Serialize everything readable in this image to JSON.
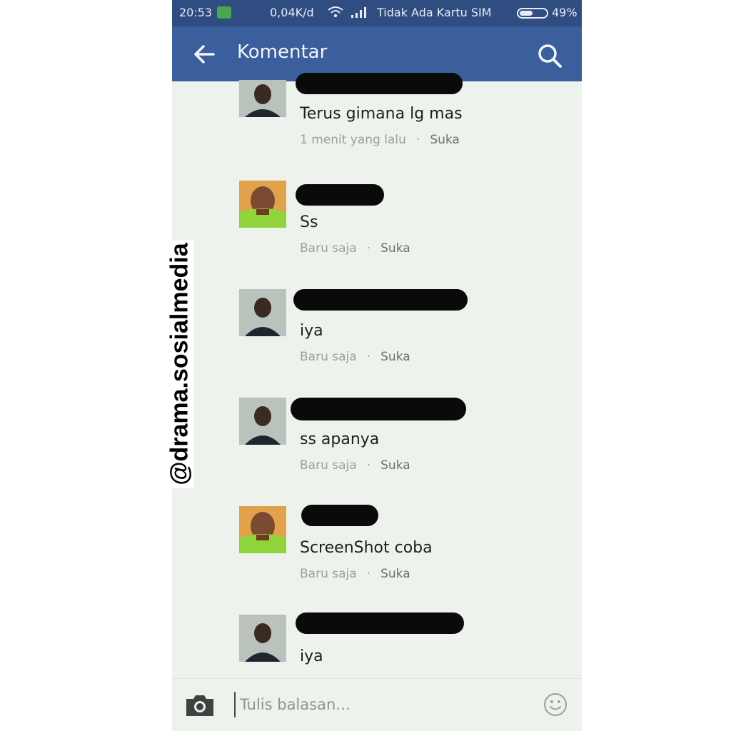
{
  "status_bar": {
    "time": "20:53",
    "speed": "0,04K/d",
    "carrier": "Tidak Ada Kartu SIM",
    "battery": "49%"
  },
  "app_bar": {
    "title": "Komentar",
    "back_icon": "arrow-left-icon",
    "search_icon": "search-icon"
  },
  "comments": [
    {
      "text": "Terus gimana lg mas",
      "time": "1 menit yang lalu",
      "like": "Suka",
      "avatar": "avatar-dark-shirt"
    },
    {
      "text": "Ss",
      "time": "Baru saja",
      "like": "Suka",
      "avatar": "avatar-green-shirt"
    },
    {
      "text": "iya",
      "time": "Baru saja",
      "like": "Suka",
      "avatar": "avatar-dark-shirt"
    },
    {
      "text": "ss apanya",
      "time": "Baru saja",
      "like": "Suka",
      "avatar": "avatar-dark-shirt"
    },
    {
      "text": "ScreenShot coba",
      "time": "Baru saja",
      "like": "Suka",
      "avatar": "avatar-green-shirt"
    },
    {
      "text": "iya",
      "avatar": "avatar-dark-shirt"
    }
  ],
  "composer": {
    "placeholder": "Tulis balasan…",
    "camera_icon": "camera-icon",
    "emoji_icon": "smiley-icon"
  },
  "watermark": "@drama.sosialmedia",
  "colors": {
    "status_bar": "#2f4d80",
    "app_bar": "#3a5f9c",
    "background": "#eef2ec"
  }
}
